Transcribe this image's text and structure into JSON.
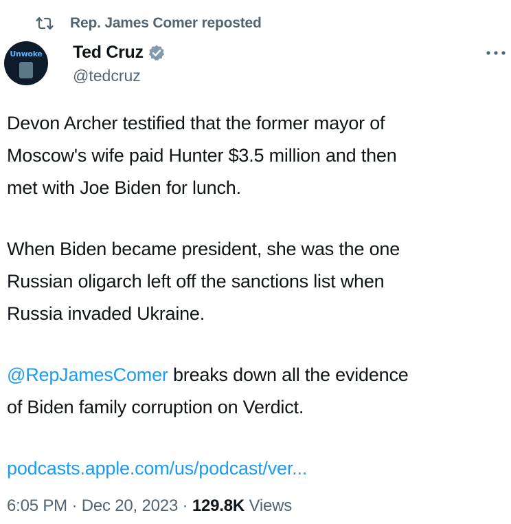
{
  "repost": {
    "label": "Rep. James Comer reposted"
  },
  "author": {
    "avatar_text": "Unwoke",
    "display_name": "Ted Cruz",
    "handle": "@tedcruz"
  },
  "tweet": {
    "para1": "Devon Archer testified that the former mayor of\nMoscow's wife paid Hunter $3.5 million and then\nmet with Joe Biden for lunch.",
    "para2": "When Biden became president, she was the one\nRussian oligarch left off the sanctions list when\nRussia invaded Ukraine.",
    "para3_mention": "@RepJamesComer",
    "para3_rest": " breaks down all the evidence\nof Biden family corruption on Verdict.",
    "link": "podcasts.apple.com/us/podcast/ver..."
  },
  "meta": {
    "time": "6:05 PM",
    "sep1": " · ",
    "date": "Dec 20, 2023",
    "sep2": " · ",
    "views_count": "129.8K",
    "views_label": " Views"
  },
  "colors": {
    "accent": "#1d9bf0",
    "text": "#0f1419",
    "secondary": "#536471",
    "verified": "#829aab"
  },
  "icons": {
    "repost": "repost-icon",
    "verified": "verified-badge-icon",
    "more": "more-options-icon"
  }
}
